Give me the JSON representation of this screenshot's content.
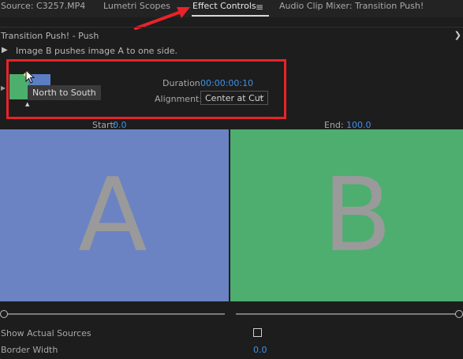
{
  "tabs": {
    "source": "Source: C3257.MP4",
    "lumetri": "Lumetri Scopes",
    "effect_controls": "Effect Controls",
    "menu_icon": "≡",
    "audio_mixer": "Audio Clip Mixer: Transition Push!"
  },
  "panel": {
    "title": "Transition Push! - Push",
    "description": "Image B pushes image A to one side.",
    "play_icon": "play-icon"
  },
  "thumbnail": {
    "tooltip": "North to South"
  },
  "settings": {
    "duration_label": "Duration",
    "duration_value": "00:00:00:10",
    "alignment_label": "Alignment:",
    "alignment_value": "Center at Cut"
  },
  "range": {
    "start_label": "Start:",
    "start_value": "0.0",
    "end_label": "End:",
    "end_value": "100.0"
  },
  "preview": {
    "a_letter": "A",
    "b_letter": "B"
  },
  "properties": {
    "show_actual_sources_label": "Show Actual Sources",
    "show_actual_sources_checked": false,
    "border_width_label": "Border Width",
    "border_width_value": "0.0"
  },
  "colors": {
    "clip_a": "#6b83c3",
    "clip_b": "#4dae6f",
    "accent_blue": "#3d92ea",
    "annotation_red": "#e8232a"
  }
}
